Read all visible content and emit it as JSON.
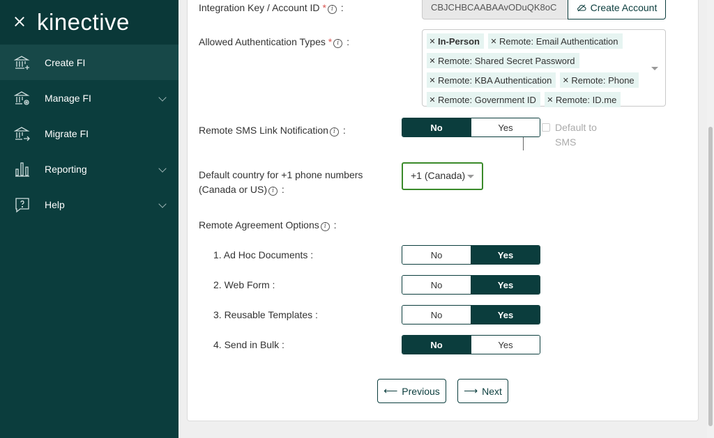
{
  "app": {
    "logo": "kinective"
  },
  "sidebar": {
    "items": [
      {
        "label": "Create FI",
        "icon": "bank-plus-icon",
        "active": true,
        "expandable": false
      },
      {
        "label": "Manage FI",
        "icon": "bank-gear-icon",
        "active": false,
        "expandable": true
      },
      {
        "label": "Migrate FI",
        "icon": "bank-arrow-icon",
        "active": false,
        "expandable": false
      },
      {
        "label": "Reporting",
        "icon": "bar-chart-icon",
        "active": false,
        "expandable": true
      },
      {
        "label": "Help",
        "icon": "help-bubble-icon",
        "active": false,
        "expandable": true
      }
    ]
  },
  "form": {
    "integration_key": {
      "label": "Integration Key / Account ID",
      "value": "CBJCHBCAABAAvODuQK8oC",
      "create_account_label": "Create Account"
    },
    "auth_types": {
      "label": "Allowed Authentication Types",
      "tags": [
        "In-Person",
        "Remote: Email Authentication",
        "Remote: Shared Secret Password",
        "Remote: KBA Authentication",
        "Remote: Phone",
        "Remote: Government ID",
        "Remote: ID.me"
      ]
    },
    "sms_link": {
      "label": "Remote SMS Link Notification",
      "no": "No",
      "yes": "Yes",
      "selected": "No",
      "default_to_sms_line1": "Default to",
      "default_to_sms_line2": "SMS"
    },
    "country": {
      "label_line1": "Default country for +1 phone numbers",
      "label_line2": "(Canada or US)",
      "value": "+1 (Canada)"
    },
    "agreement": {
      "label": "Remote Agreement Options",
      "options": [
        {
          "label": "1. Ad Hoc Documents :",
          "selected": "Yes"
        },
        {
          "label": "2. Web Form :",
          "selected": "Yes"
        },
        {
          "label": "3. Reusable Templates :",
          "selected": "Yes"
        },
        {
          "label": "4. Send in Bulk :",
          "selected": "No"
        }
      ],
      "no": "No",
      "yes": "Yes"
    }
  },
  "buttons": {
    "previous": "Previous",
    "next": "Next"
  },
  "colors": {
    "sidebar": "#0b3d3d",
    "tag": "#e6f4f1",
    "focus": "#3a8a2a",
    "required": "#d9534f"
  }
}
